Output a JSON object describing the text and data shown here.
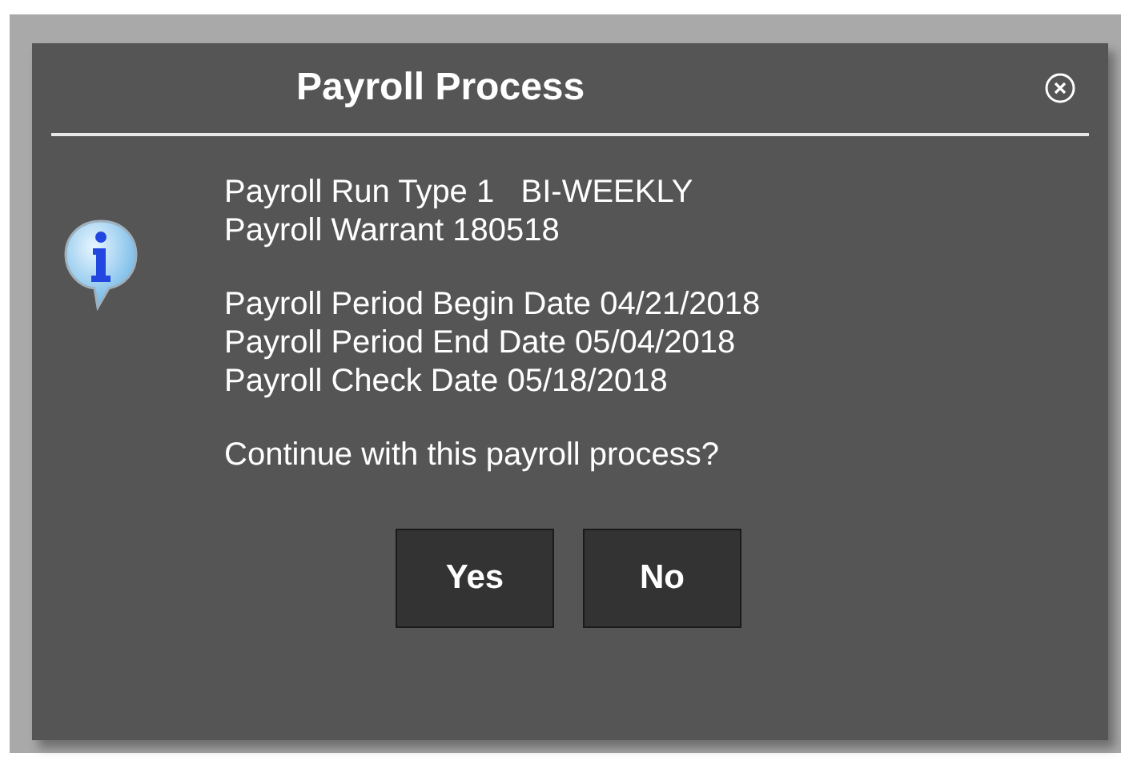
{
  "dialog": {
    "title": "Payroll Process",
    "paragraphs": [
      [
        "Payroll Run Type 1   BI-WEEKLY",
        "Payroll Warrant 180518"
      ],
      [
        "Payroll Period Begin Date 04/21/2018",
        "Payroll Period End Date 05/04/2018",
        "Payroll Check Date 05/18/2018"
      ],
      [
        "Continue with this payroll process?"
      ]
    ],
    "buttons": [
      "Yes",
      "No"
    ]
  }
}
